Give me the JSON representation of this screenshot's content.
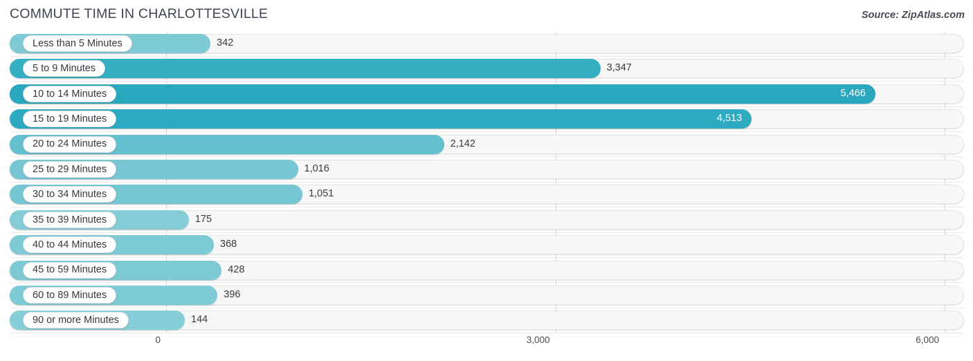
{
  "header": {
    "title": "COMMUTE TIME IN CHARLOTTESVILLE",
    "source": "Source: ZipAtlas.com"
  },
  "chart_data": {
    "type": "bar",
    "orientation": "horizontal",
    "title": "COMMUTE TIME IN CHARLOTTESVILLE",
    "xlabel": "",
    "ylabel": "",
    "xlim": [
      0,
      6000
    ],
    "grid": true,
    "legend": "none",
    "xticks": [
      "0",
      "3,000",
      "6,000"
    ],
    "xtick_values": [
      0,
      3000,
      6000
    ],
    "categories": [
      "Less than 5 Minutes",
      "5 to 9 Minutes",
      "10 to 14 Minutes",
      "15 to 19 Minutes",
      "20 to 24 Minutes",
      "25 to 29 Minutes",
      "30 to 34 Minutes",
      "35 to 39 Minutes",
      "40 to 44 Minutes",
      "45 to 59 Minutes",
      "60 to 89 Minutes",
      "90 or more Minutes"
    ],
    "values": [
      342,
      3347,
      5466,
      4513,
      2142,
      1016,
      1051,
      175,
      368,
      428,
      396,
      144
    ],
    "value_labels": [
      "342",
      "3,347",
      "5,466",
      "4,513",
      "2,142",
      "1,016",
      "1,051",
      "175",
      "368",
      "428",
      "396",
      "144"
    ],
    "bar_colors": [
      "#7ecbd5",
      "#35b0c3",
      "#29a7bc",
      "#2eabc0",
      "#62c0cf",
      "#76c7d3",
      "#75c6d3",
      "#84cdd7",
      "#7fcbd5",
      "#7dcad5",
      "#7ecbd5",
      "#86ced8"
    ],
    "label_inside": [
      false,
      false,
      true,
      true,
      false,
      false,
      false,
      false,
      false,
      false,
      false,
      false
    ]
  },
  "colors": {
    "accent": "#29a7bc",
    "accent_light": "#86ced8",
    "track": "#f7f7f7",
    "gridline": "#d5d5d8",
    "text": "#3c3c46"
  }
}
